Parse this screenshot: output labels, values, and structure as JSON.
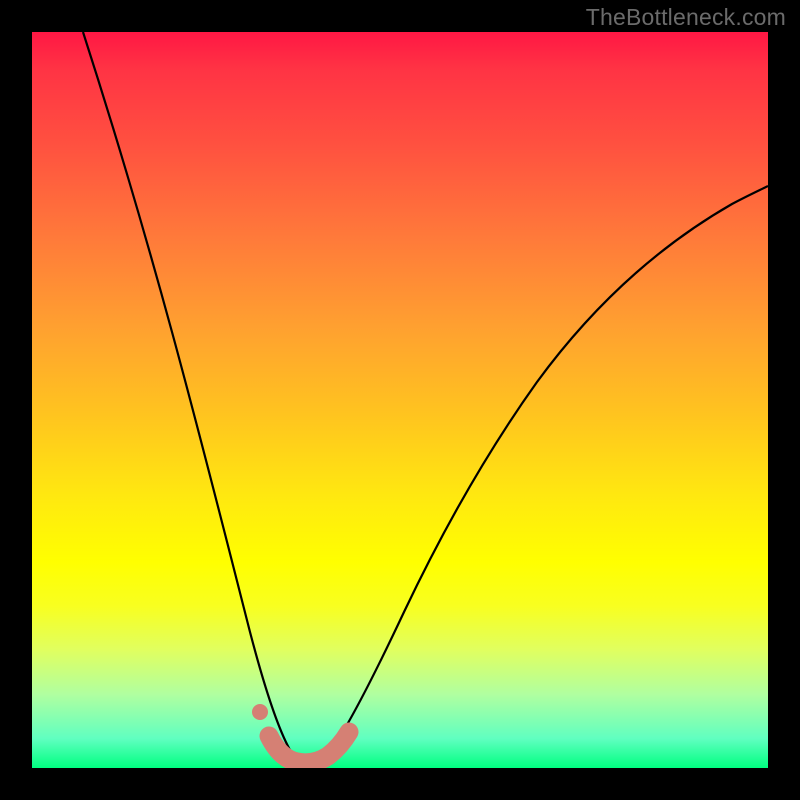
{
  "watermark": "TheBottleneck.com",
  "chart_data": {
    "type": "line",
    "title": "",
    "xlabel": "",
    "ylabel": "",
    "xlim": [
      0,
      100
    ],
    "ylim": [
      0,
      100
    ],
    "legend": false,
    "grid": false,
    "background_gradient": {
      "top_color": "#ff1744",
      "bottom_color": "#00ff80",
      "meaning": "bottleneck severity (red high, green low)"
    },
    "series": [
      {
        "name": "bottleneck-curve",
        "stroke": "#000000",
        "x": [
          7,
          10,
          13,
          16,
          19,
          22,
          25,
          28,
          30,
          32,
          34,
          36,
          37.5,
          40,
          43,
          47,
          52,
          58,
          65,
          73,
          82,
          92,
          100
        ],
        "values": [
          100,
          88,
          76,
          64,
          53,
          42,
          32,
          22,
          14,
          8,
          3,
          0.5,
          0.5,
          3,
          9,
          18,
          29,
          40,
          50,
          59,
          66,
          72,
          77
        ]
      },
      {
        "name": "highlight-band",
        "stroke": "#d97070",
        "stroke_width_px": 18,
        "x": [
          30,
          32,
          34,
          36,
          38,
          40
        ],
        "values": [
          3.2,
          1.4,
          0.6,
          0.6,
          1.4,
          3.2
        ]
      },
      {
        "name": "highlight-dot",
        "type": "scatter",
        "color": "#d97070",
        "x": [
          30.5
        ],
        "values": [
          9
        ]
      }
    ],
    "annotations": []
  }
}
